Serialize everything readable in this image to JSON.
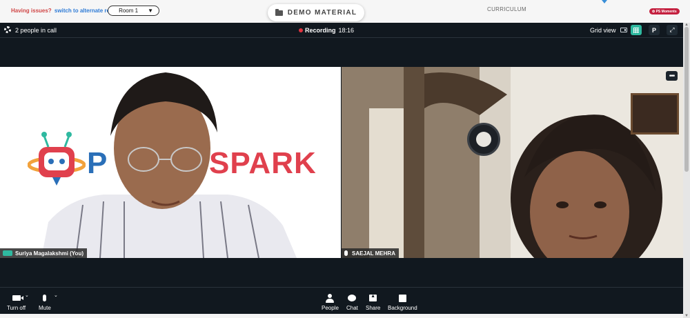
{
  "top": {
    "issues_text": "Having issues?",
    "switch_link": "switch to alternate room",
    "room_select": "Room 1",
    "demo_button": "DEMO MATERIAL",
    "curriculum": "CURRICULUM",
    "moments_badge": "PS Moments"
  },
  "call_bar": {
    "people_count": "2 people in call",
    "recording_label": "Recording",
    "recording_time": "18:16",
    "view_label": "Grid view",
    "avatar_letter": "P"
  },
  "tiles": [
    {
      "name": "Suriya Magalakshmi (You)",
      "brand_left": "P",
      "brand_right": "SPARK"
    },
    {
      "name": "SAEJAL MEHRA",
      "more": "•••"
    }
  ],
  "controls": {
    "turn_off": "Turn off",
    "mute": "Mute",
    "people": "People",
    "chat": "Chat",
    "share": "Share",
    "background": "Background"
  },
  "colors": {
    "call_bg": "#11181f",
    "accent": "#2fb9a0",
    "recording_dot": "#e0333f",
    "brand_red": "#e0404d",
    "link_blue": "#2e7bd6"
  }
}
